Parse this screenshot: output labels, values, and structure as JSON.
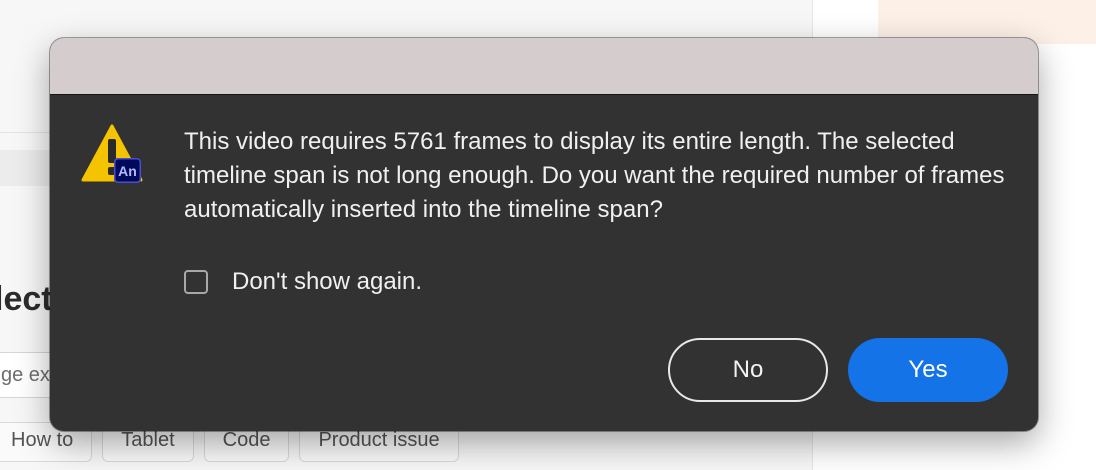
{
  "background": {
    "heading_fragment": "lect",
    "input_fragment": "ge ext",
    "tags": [
      "How to",
      "Tablet",
      "Code",
      "Product issue"
    ]
  },
  "dialog": {
    "icon": "warning-icon",
    "app_badge": "An",
    "message": "This video requires 5761 frames to display its entire length. The selected timeline span is not long enough. Do you want the required number of frames automatically inserted into the timeline span?",
    "checkbox": {
      "label": "Don't show again.",
      "checked": false
    },
    "buttons": {
      "no_label": "No",
      "yes_label": "Yes"
    }
  },
  "colors": {
    "dialog_bg": "#323232",
    "titlebar_bg": "#d5cdcd",
    "accent": "#1473e6",
    "warning": "#f5c400"
  }
}
